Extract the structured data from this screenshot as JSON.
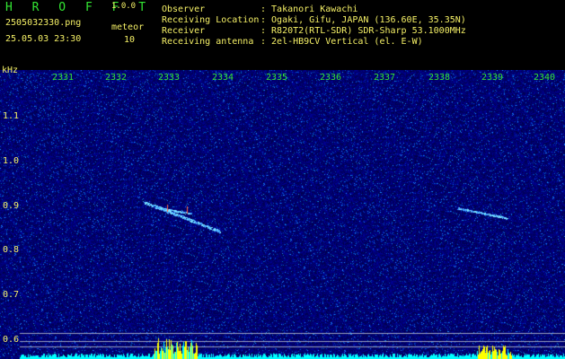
{
  "app": {
    "title": "H R O F F T",
    "version": "1.0.0"
  },
  "file": {
    "name": "2505032330.png",
    "datetime": "25.05.03 23:30",
    "meteor_label": "meteor",
    "meteor_count": "10"
  },
  "station": {
    "labels": [
      "Observer",
      "Receiving Location",
      "Receiver",
      "Receiving antenna"
    ],
    "values": [
      ": Takanori Kawachi",
      ": Ogaki, Gifu, JAPAN (136.60E, 35.35N)",
      ": R820T2(RTL-SDR) SDR-Sharp 53.1000MHz",
      ": 2el-HB9CV Vertical (el. E-W)"
    ]
  },
  "axis": {
    "unit": "kHz",
    "time_ticks": [
      "2331",
      "2332",
      "2333",
      "2334",
      "2335",
      "2336",
      "2337",
      "2338",
      "2339",
      "2340"
    ],
    "freq_ticks": [
      "1.1",
      "1.0",
      "0.9",
      "0.8",
      "0.7",
      "0.6"
    ]
  },
  "colors": {
    "background_noise": "#00007a",
    "echo": "#5fd0ff",
    "label_green": "#33e633",
    "label_yellow": "#f5f066",
    "level_cyan": "#00ffff",
    "level_yellow": "#ffff00"
  }
}
